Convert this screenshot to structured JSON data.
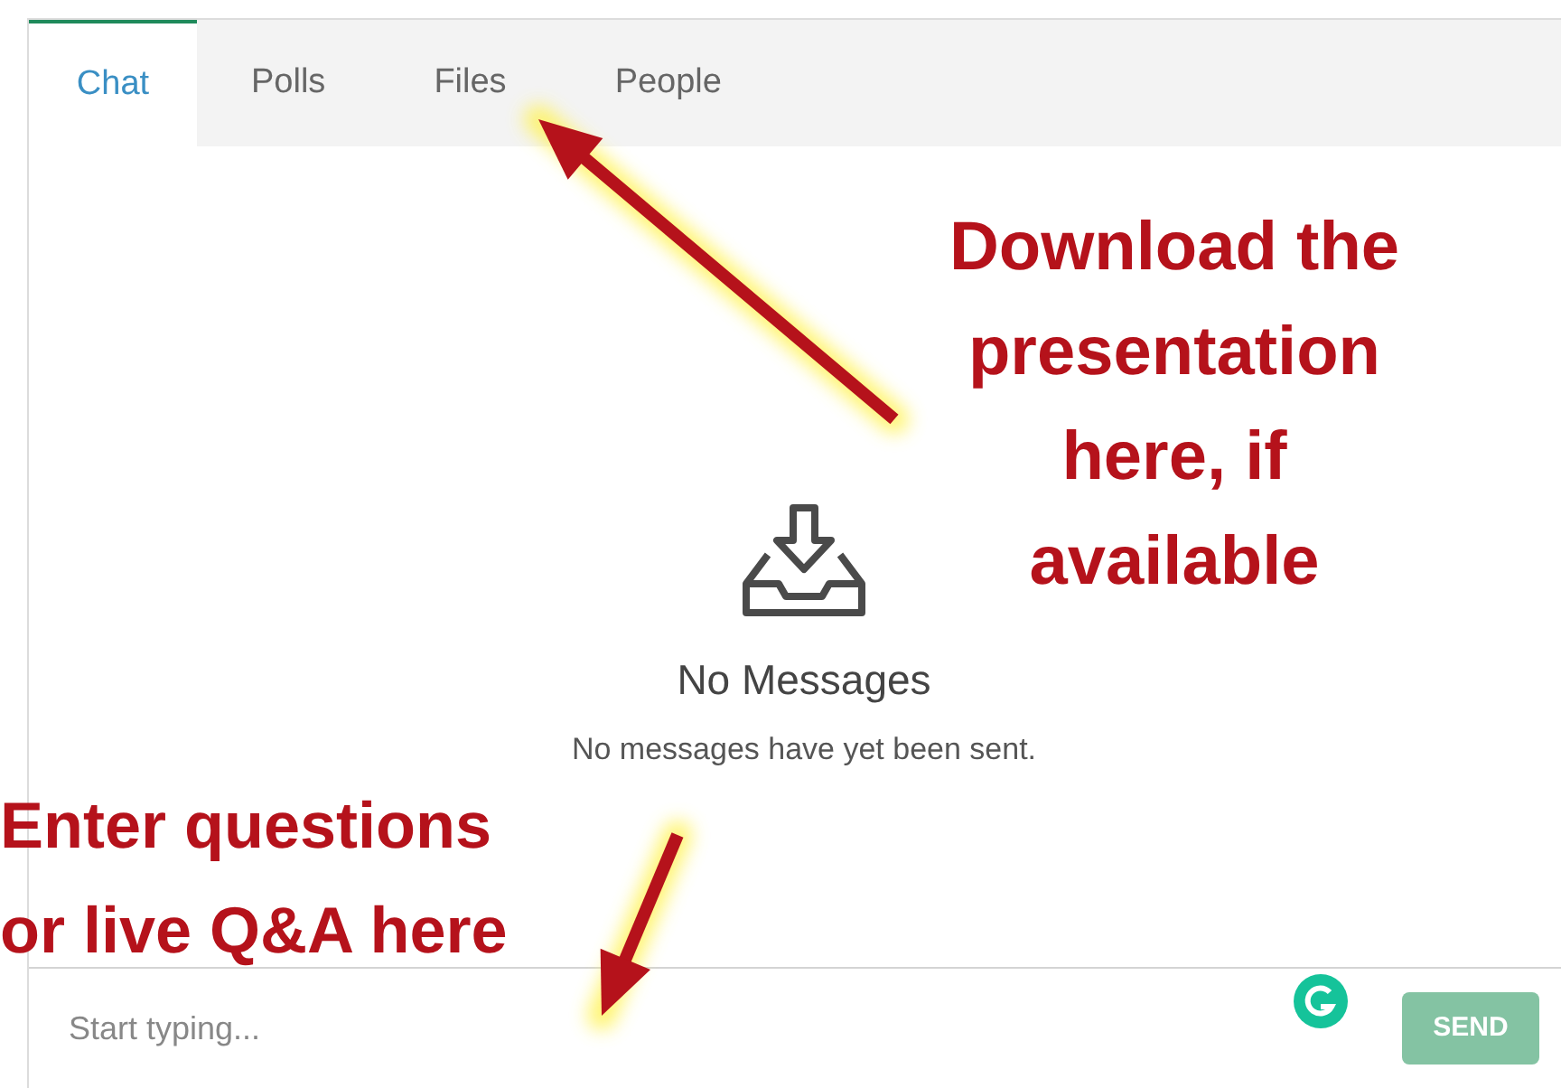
{
  "tabs": [
    {
      "label": "Chat",
      "selected": true
    },
    {
      "label": "Polls",
      "selected": false
    },
    {
      "label": "Files",
      "selected": false
    },
    {
      "label": "People",
      "selected": false
    }
  ],
  "empty_state": {
    "title": "No Messages",
    "text": "No messages have yet been sent."
  },
  "composer": {
    "placeholder": "Start typing...",
    "send": "SEND"
  },
  "annotations": [
    {
      "lines": [
        "Download the",
        "presentation",
        "here, if",
        "available"
      ]
    },
    {
      "lines": [
        "Enter questions",
        "or live Q&A here"
      ]
    }
  ]
}
